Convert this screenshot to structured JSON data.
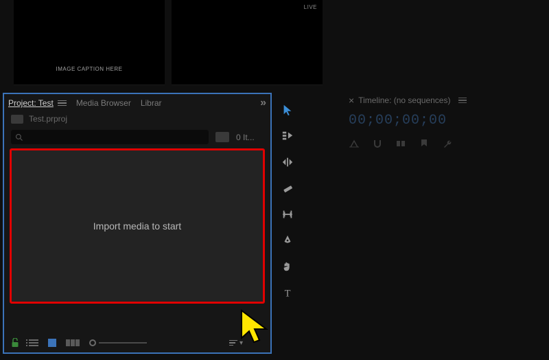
{
  "previews": {
    "caption": "IMAGE CAPTION HERE",
    "live": "LIVE"
  },
  "project_panel": {
    "tabs": {
      "project": "Project: Test",
      "media_browser": "Media Browser",
      "libraries": "Librar"
    },
    "overflow": "»",
    "filename": "Test.prproj",
    "item_count": "0 It...",
    "drop_hint": "Import media to start"
  },
  "timeline": {
    "title": "Timeline: (no sequences)",
    "timecode": "00;00;00;00"
  }
}
